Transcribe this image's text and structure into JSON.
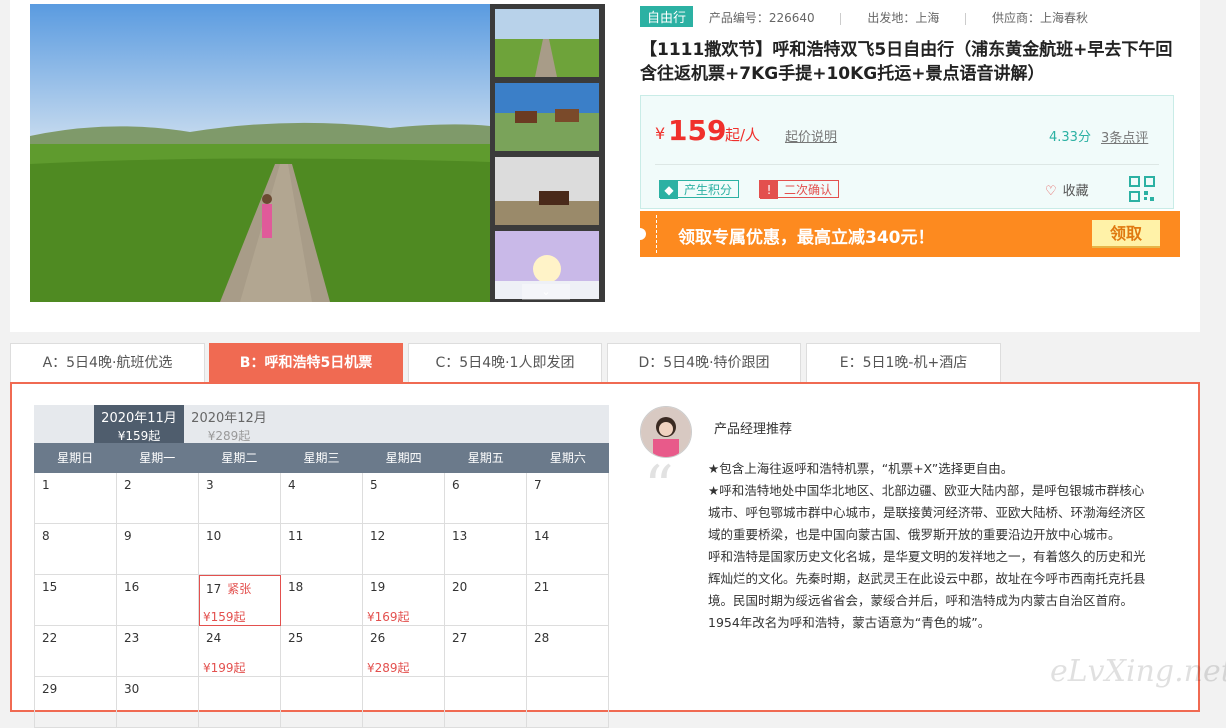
{
  "product": {
    "type_tag": "自由行",
    "code_label": "产品编号：226640",
    "departure_label": "出发地：上海",
    "supplier_label": "供应商：上海春秋",
    "title": "【1111撒欢节】呼和浩特双飞5日自由行（浦东黄金航班+早去下午回 含往返机票+7KG手提+10KG托运+景点语音讲解）"
  },
  "price": {
    "currency": "¥",
    "amount": "159",
    "unit": "起/人",
    "explain_link": "起价说明",
    "score": "4.33分",
    "reviews_link": "3条点评"
  },
  "badges": {
    "points_icon": "diamond-icon",
    "points": "产生积分",
    "confirm_icon": "exclamation-icon",
    "confirm": "二次确认"
  },
  "favorite": {
    "icon": "heart-icon",
    "label": "收藏"
  },
  "promo": {
    "text": "领取专属优惠，最高立减340元！",
    "button": "领取"
  },
  "tabs": [
    {
      "label": "A：5日4晚·航班优选"
    },
    {
      "label": "B：呼和浩特5日机票"
    },
    {
      "label": "C：5日4晚·1人即发团"
    },
    {
      "label": "D：5日4晚·特价跟团"
    },
    {
      "label": "E：5日1晚-机+酒店"
    }
  ],
  "calendar": {
    "months": [
      {
        "label": "2020年11月",
        "price": "¥159起"
      },
      {
        "label": "2020年12月",
        "price": "¥289起"
      }
    ],
    "weekdays": [
      "星期日",
      "星期一",
      "星期二",
      "星期三",
      "星期四",
      "星期五",
      "星期六"
    ],
    "weeks": [
      [
        {
          "d": "1"
        },
        {
          "d": "2"
        },
        {
          "d": "3"
        },
        {
          "d": "4"
        },
        {
          "d": "5"
        },
        {
          "d": "6"
        },
        {
          "d": "7"
        }
      ],
      [
        {
          "d": "8"
        },
        {
          "d": "9"
        },
        {
          "d": "10"
        },
        {
          "d": "11"
        },
        {
          "d": "12"
        },
        {
          "d": "13"
        },
        {
          "d": "14"
        }
      ],
      [
        {
          "d": "15"
        },
        {
          "d": "16"
        },
        {
          "d": "17",
          "tag": "紧张",
          "price": "¥159起",
          "selected": true
        },
        {
          "d": "18"
        },
        {
          "d": "19",
          "price": "¥169起"
        },
        {
          "d": "20"
        },
        {
          "d": "21"
        }
      ],
      [
        {
          "d": "22"
        },
        {
          "d": "23"
        },
        {
          "d": "24",
          "price": "¥199起"
        },
        {
          "d": "25"
        },
        {
          "d": "26",
          "price": "¥289起"
        },
        {
          "d": "27"
        },
        {
          "d": "28"
        }
      ],
      [
        {
          "d": "29"
        },
        {
          "d": "30"
        },
        {
          "d": ""
        },
        {
          "d": ""
        },
        {
          "d": ""
        },
        {
          "d": ""
        },
        {
          "d": ""
        }
      ]
    ]
  },
  "recommend": {
    "title": "产品经理推荐",
    "paragraphs": [
      "★包含上海往返呼和浩特机票，“机票+X”选择更自由。",
      "★呼和浩特地处中国华北地区、北部边疆、欧亚大陆内部，是呼包银城市群核心城市、呼包鄂城市群中心城市，是联接黄河经济带、亚欧大陆桥、环渤海经济区域的重要桥梁，也是中国向蒙古国、俄罗斯开放的重要沿边开放中心城市。",
      "呼和浩特是国家历史文化名城，是华夏文明的发祥地之一，有着悠久的历史和光辉灿烂的文化。先秦时期，赵武灵王在此设云中郡，故址在今呼市西南托克托县境。民国时期为绥远省省会，蒙绥合并后，呼和浩特成为内蒙古自治区首府。1954年改名为呼和浩特，蒙古语意为“青色的城”。"
    ]
  },
  "watermark": "eLvXing.net",
  "colors": {
    "accent": "#f06a52",
    "teal": "#2cb1a3",
    "price_red": "#f0302c",
    "promo_orange": "#fd8a1f"
  }
}
